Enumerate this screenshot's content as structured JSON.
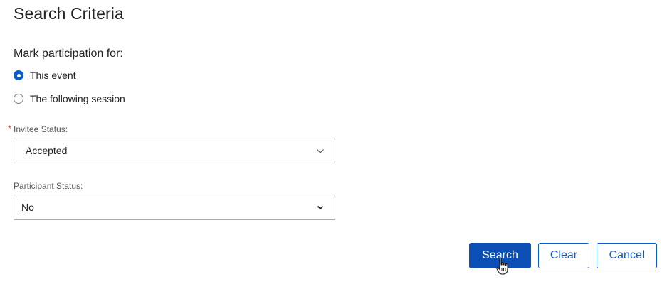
{
  "header": {
    "title": "Search Criteria"
  },
  "participation": {
    "label": "Mark participation for:",
    "options": [
      {
        "label": "This event",
        "selected": true
      },
      {
        "label": "The following session",
        "selected": false
      }
    ]
  },
  "invitee_status": {
    "required_marker": "*",
    "label": "Invitee Status:",
    "value": "Accepted"
  },
  "participant_status": {
    "label": "Participant Status:",
    "value": "No"
  },
  "actions": {
    "search_label": "Search",
    "clear_label": "Clear",
    "cancel_label": "Cancel"
  },
  "colors": {
    "primary": "#0b4fb4",
    "accent": "#0b5cc9",
    "required": "#c0392b"
  },
  "icons": {
    "select_indicator": "chevron-down-icon",
    "pointer": "hand-cursor-icon"
  }
}
